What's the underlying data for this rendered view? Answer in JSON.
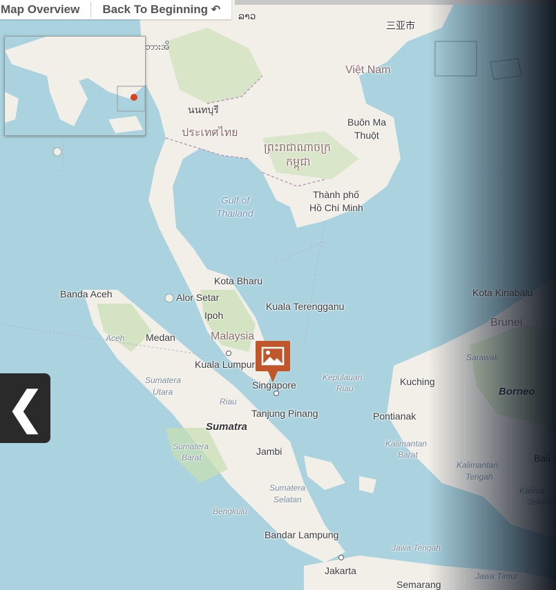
{
  "toolbar": {
    "overview_label": "Map Overview",
    "back_label": "Back To Beginning"
  },
  "labels": {
    "china": "三亚市",
    "laos": "ລາວ",
    "myanmar": "ဘားအိ",
    "vietnam": "Việt Nam",
    "nonthaburi": "นนทบุรี",
    "thailand": "ประเทศไทย",
    "buon_ma": "Buôn Ma",
    "thuot": "Thuột",
    "cambodia_1": "ព្រះរាជាណាចក្រ",
    "cambodia_2": "កម្ពុជា",
    "hcm_1": "Thành phố",
    "hcm_2": "Hồ Chí Minh",
    "gulf_1": "Gulf of",
    "gulf_2": "Thailand",
    "kota_bharu": "Kota Bharu",
    "banda_aceh": "Banda Aceh",
    "alor_setar": "Alor Setar",
    "kuala_terengganu": "Kuala Terengganu",
    "ipoh": "Ipoh",
    "kota_kinabalu": "Kota Kinabalu",
    "brunei": "Brunei",
    "aceh": "Aceh",
    "medan": "Medan",
    "malaysia": "Malaysia",
    "sarawak": "Sarawak",
    "kuala_lumpur": "Kuala Lumpur",
    "borneo": "Borneo",
    "sumatera_utara_1": "Sumatera",
    "sumatera_utara_2": "Utara",
    "singapore": "Singapore",
    "kepulauan_1": "Kepulauan",
    "kepulauan_2": "Riau",
    "kuching": "Kuching",
    "riau": "Riau",
    "tanjung_pinang": "Tanjung Pinang",
    "pontianak": "Pontianak",
    "sumatra": "Sumatra",
    "kalbar_1": "Kalimantan",
    "kalbar_2": "Barat",
    "kalteng_1": "Kalimantan",
    "kalteng_2": "Tengah",
    "sumbar_1": "Sumatera",
    "sumbar_2": "Barat",
    "jambi": "Jambi",
    "bali": "Bali",
    "sumsel_1": "Sumatera",
    "sumsel_2": "Selatan",
    "kalsel_1": "Kalima",
    "kalsel_2": "Selata",
    "bengkulu": "Bengkulu",
    "bandar_lampung": "Bandar Lampung",
    "jawa_tengah": "Jawa Tengah",
    "jakarta": "Jakarta",
    "jawa_timur": "Jawa Timur",
    "semarang": "Semarang"
  },
  "colors": {
    "water": "#aad3df",
    "land": "#f2efe9",
    "forest": "#c7dfb0",
    "marker": "#c0562a",
    "back_button": "#2a2a2a"
  },
  "icons": {
    "marker": "image-icon",
    "back": "chevron-left-icon",
    "undo": "undo-arrow-icon"
  }
}
